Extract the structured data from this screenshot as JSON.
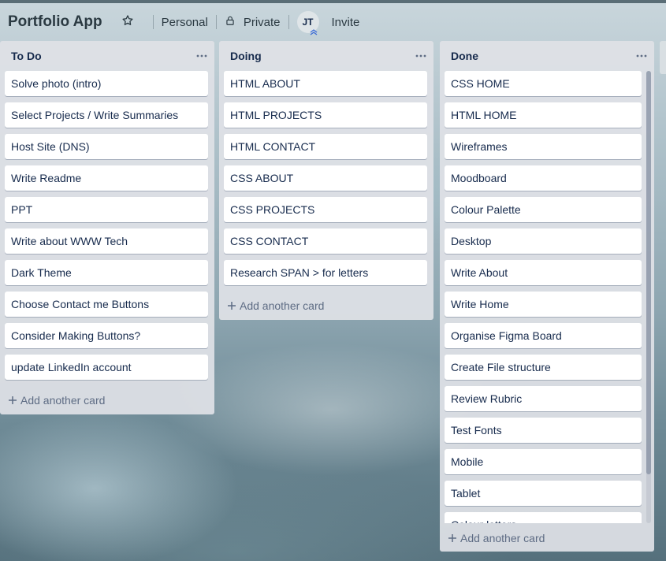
{
  "header": {
    "board_title": "Portfolio App",
    "workspace_label": "Personal",
    "visibility_label": "Private",
    "avatar_initials": "JT",
    "invite_label": "Invite"
  },
  "lists": {
    "todo": {
      "title": "To Do",
      "cards": [
        "Solve photo (intro)",
        "Select Projects / Write Summaries",
        "Host Site (DNS)",
        "Write Readme",
        "PPT",
        "Write about WWW Tech",
        "Dark Theme",
        "Choose Contact me Buttons",
        "Consider Making Buttons?",
        "update LinkedIn account"
      ],
      "add_label": "Add another card"
    },
    "doing": {
      "title": "Doing",
      "cards": [
        "HTML ABOUT",
        "HTML PROJECTS",
        "HTML CONTACT",
        "CSS ABOUT",
        "CSS PROJECTS",
        "CSS CONTACT",
        "Research SPAN > for letters"
      ],
      "add_label": "Add another card"
    },
    "done": {
      "title": "Done",
      "cards": [
        "CSS HOME",
        "HTML HOME",
        "Wireframes",
        "Moodboard",
        "Colour Palette",
        "Desktop",
        "Write About",
        "Write Home",
        "Organise Figma Board",
        "Create File structure",
        "Review Rubric",
        "Test Fonts",
        "Mobile",
        "Tablet",
        "Colour letters"
      ],
      "add_label": "Add another card"
    }
  },
  "icons": {
    "star": "star-icon",
    "lock": "lock-icon",
    "menu": "more-horizontal-icon",
    "plus": "plus-icon"
  }
}
